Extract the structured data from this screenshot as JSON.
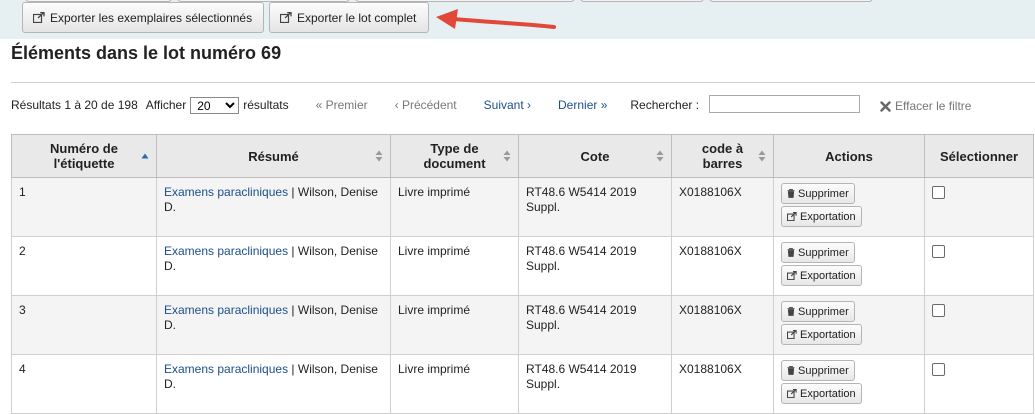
{
  "toolbar": {
    "export_selected_label": "Exporter les exemplaires sélectionnés",
    "export_all_label": "Exporter le lot complet",
    "accent_arrow_color": "#e0483a"
  },
  "page_title": "Éléments dans le lot numéro 69",
  "pager": {
    "results_info": "Résultats 1 à 20 de 198",
    "show_label": "Afficher",
    "per_page_value": "20",
    "results_label": "résultats",
    "first": "« Premier",
    "previous": "‹ Précédent",
    "next": "Suivant ›",
    "last": "Dernier »",
    "search_label": "Rechercher :",
    "clear_filter": "Effacer le filtre"
  },
  "table": {
    "headers": [
      "Numéro de l'étiquette",
      "Résumé",
      "Type de document",
      "Cote",
      "code à barres",
      "Actions",
      "Sélectionner"
    ],
    "delete_label": "Supprimer",
    "export_label": "Exportation",
    "rows": [
      {
        "label": "1",
        "title": "Examens paracliniques",
        "author": " | Wilson, Denise D.",
        "type": "Livre imprimé",
        "call_number": "RT48.6 W5414 2019 Suppl.",
        "barcode": "X0188106X"
      },
      {
        "label": "2",
        "title": "Examens paracliniques",
        "author": " | Wilson, Denise D.",
        "type": "Livre imprimé",
        "call_number": "RT48.6 W5414 2019 Suppl.",
        "barcode": "X0188106X"
      },
      {
        "label": "3",
        "title": "Examens paracliniques",
        "author": " | Wilson, Denise D.",
        "type": "Livre imprimé",
        "call_number": "RT48.6 W5414 2019 Suppl.",
        "barcode": "X0188106X"
      },
      {
        "label": "4",
        "title": "Examens paracliniques",
        "author": " | Wilson, Denise D.",
        "type": "Livre imprimé",
        "call_number": "RT48.6 W5414 2019 Suppl.",
        "barcode": "X0188106X"
      }
    ]
  }
}
